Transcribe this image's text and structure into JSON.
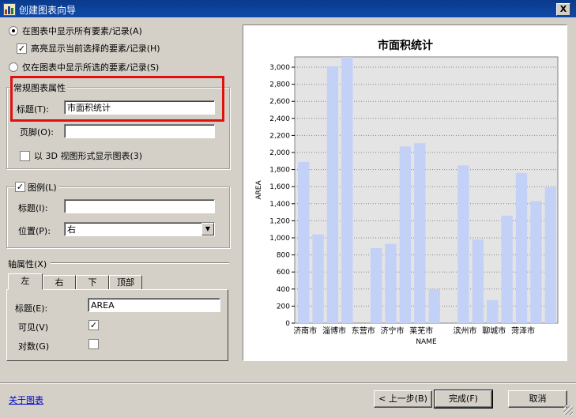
{
  "window": {
    "title": "创建图表向导",
    "close_glyph": "X"
  },
  "options": {
    "radio_all": "在图表中显示所有要素/记录(A)",
    "highlight": "高亮显示当前选择的要素/记录(H)",
    "radio_selected": "仅在图表中显示所选的要素/记录(S)",
    "radio_all_checked": true,
    "highlight_checked": true
  },
  "general": {
    "group_label": "常规图表属性",
    "title_label": "标题(T):",
    "title_value": "市面积统计",
    "footer_label": "页脚(O):",
    "footer_value": "",
    "three_d_label": "以 3D 视图形式显示图表(3)",
    "three_d_checked": false
  },
  "legend": {
    "group_label": "图例(L)",
    "enabled": true,
    "title_label": "标题(I):",
    "title_value": "",
    "position_label": "位置(P):",
    "position_value": "右"
  },
  "axis": {
    "section_label": "轴属性(X)",
    "tabs": [
      "左",
      "右",
      "下",
      "顶部"
    ],
    "active_tab": "左",
    "title_label": "标题(E):",
    "title_value": "AREA",
    "visible_label": "可见(V)",
    "visible_checked": true,
    "log_label": "对数(G)",
    "log_checked": false
  },
  "footer": {
    "about_link": "关于图表",
    "back_button": "< 上一步(B)",
    "finish_button": "完成(F)",
    "cancel_button": "取消"
  },
  "colors": {
    "bar": "#c3d1f7",
    "plot_bg": "#e4e4e4",
    "highlight_box": "#e01010"
  },
  "chart_data": {
    "type": "bar",
    "title": "市面积统计",
    "xlabel": "NAME",
    "ylabel": "AREA",
    "ylim": [
      0,
      3000
    ],
    "yticks": [
      0,
      200,
      400,
      600,
      800,
      1000,
      1200,
      1400,
      1600,
      1800,
      2000,
      2200,
      2400,
      2600,
      2800,
      3000
    ],
    "ytick_labels": [
      "0",
      "200",
      "400",
      "600",
      "800",
      "1,000",
      "1,200",
      "1,400",
      "1,600",
      "1,800",
      "2,000",
      "2,200",
      "2,400",
      "2,600",
      "2,800",
      "3,000"
    ],
    "bar_values": [
      1890,
      1040,
      3010,
      3120,
      0,
      880,
      930,
      2070,
      2110,
      400,
      0,
      1850,
      980,
      270,
      1260,
      1760,
      1430,
      1590
    ],
    "x_tick_labels": [
      "济南市",
      "淄博市",
      "东营市",
      "济宁市",
      "莱芜市",
      "滨州市",
      "聊城市",
      "菏泽市"
    ],
    "x_tick_bar_index": [
      0,
      2,
      4,
      6,
      8,
      11,
      13,
      15
    ]
  }
}
